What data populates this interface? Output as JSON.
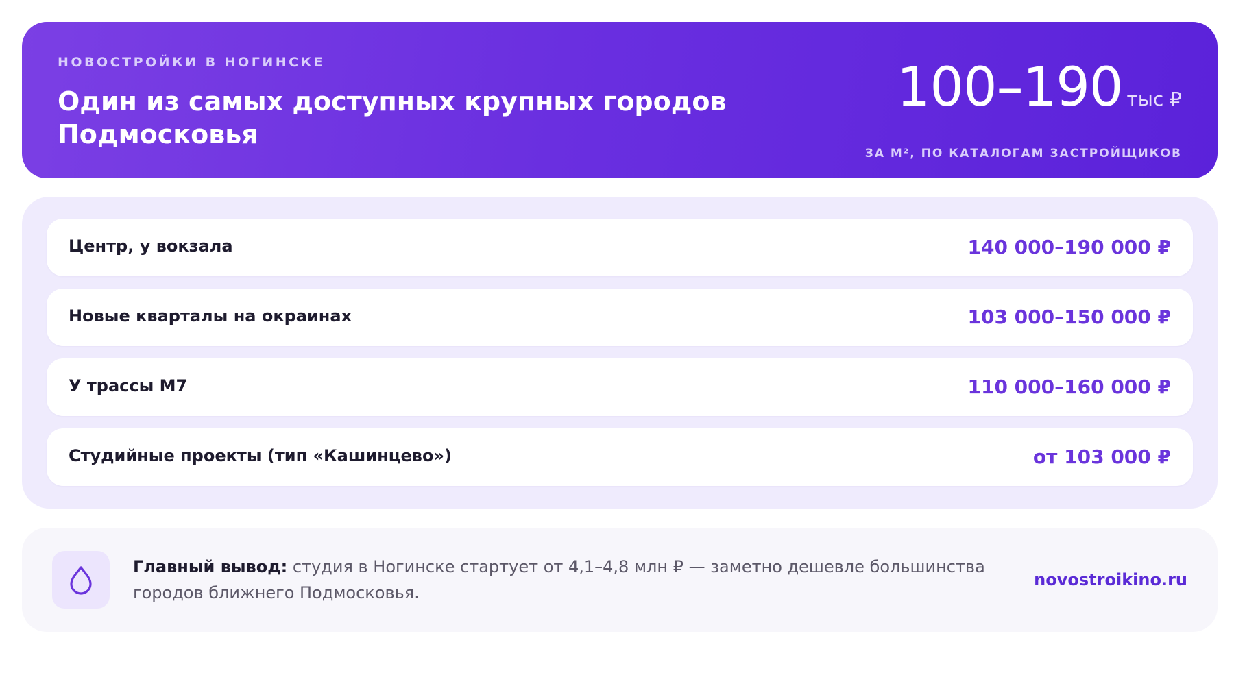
{
  "hero": {
    "eyebrow": "НОВОСТРОЙКИ В НОГИНСКЕ",
    "title": "Один из самых доступных крупных городов Подмосковья",
    "price_range": "100–190",
    "price_unit": "тыс ₽",
    "price_caption": "ЗА М², ПО КАТАЛОГАМ ЗАСТРОЙЩИКОВ"
  },
  "price_rows": [
    {
      "label": "Центр, у вокзала",
      "value": "140 000–190 000 ₽"
    },
    {
      "label": "Новые кварталы на окраинах",
      "value": "103 000–150 000 ₽"
    },
    {
      "label": "У трассы М7",
      "value": "110 000–160 000 ₽"
    },
    {
      "label": "Студийные проекты (тип «Кашинцево»)",
      "value": "от 103 000 ₽"
    }
  ],
  "summary": {
    "icon": "drop-icon",
    "lead": "Главный вывод:",
    "text": " студия в Ногинске стартует от 4,1–4,8 млн ₽ — заметно дешевле большинства городов ближнего Подмосковья.",
    "link": "novostroikino.ru"
  },
  "colors": {
    "accent": "#6a34dc",
    "hero_start": "#7b3fe4",
    "hero_end": "#5b22da",
    "panel_bg": "#efebfd",
    "summary_bg": "#f7f6fb"
  }
}
